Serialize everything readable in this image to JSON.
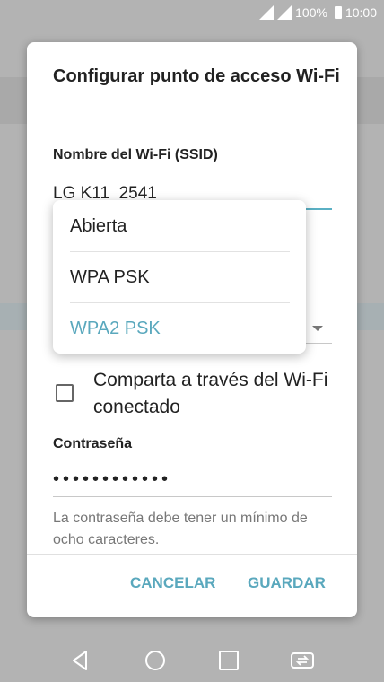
{
  "status_bar": {
    "battery": "100%",
    "time": "10:00"
  },
  "dialog": {
    "title": "Configurar punto de acceso Wi-Fi",
    "ssid_label": "Nombre del Wi-Fi (SSID)",
    "ssid_value": "LG K11_2541",
    "share_checkbox_label": "Comparta a través del Wi-Fi conectado",
    "share_checked": false,
    "password_label": "Contraseña",
    "password_masked": "••••••••••••",
    "password_hint": "La contraseña debe tener un mínimo de ocho caracteres.",
    "cancel_label": "CANCELAR",
    "save_label": "GUARDAR"
  },
  "security_menu": {
    "items": [
      {
        "label": "Abierta",
        "selected": false
      },
      {
        "label": "WPA PSK",
        "selected": false
      },
      {
        "label": "WPA2 PSK",
        "selected": true
      }
    ]
  },
  "colors": {
    "accent": "#5aa8bd",
    "scrim": "#9a9a9a"
  }
}
